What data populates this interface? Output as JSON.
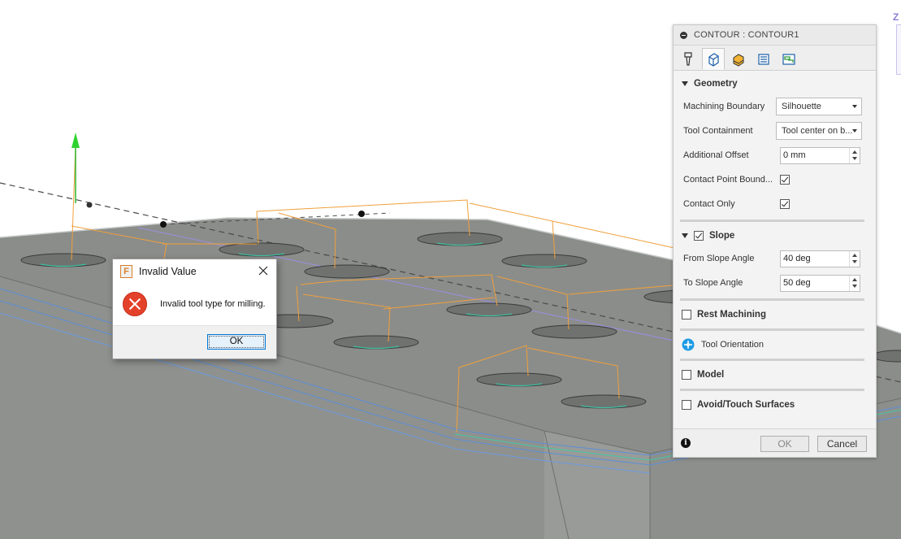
{
  "panel": {
    "title": "CONTOUR : CONTOUR1",
    "geometry": {
      "header": "Geometry",
      "machining_boundary": {
        "label": "Machining Boundary",
        "value": "Silhouette"
      },
      "tool_containment": {
        "label": "Tool Containment",
        "value": "Tool center on b..."
      },
      "additional_offset": {
        "label": "Additional Offset",
        "value": "0 mm"
      },
      "contact_point_boundary": {
        "label": "Contact Point Bound...",
        "checked": true
      },
      "contact_only": {
        "label": "Contact Only",
        "checked": true
      }
    },
    "slope": {
      "header": "Slope",
      "checked": true,
      "from_angle": {
        "label": "From Slope Angle",
        "value": "40 deg"
      },
      "to_angle": {
        "label": "To Slope Angle",
        "value": "50 deg"
      }
    },
    "rest_machining": {
      "label": "Rest Machining",
      "checked": false
    },
    "tool_orientation": {
      "label": "Tool Orientation"
    },
    "model": {
      "label": "Model",
      "checked": false
    },
    "avoid_touch": {
      "label": "Avoid/Touch Surfaces",
      "checked": false
    },
    "ok_label": "OK",
    "cancel_label": "Cancel"
  },
  "dialog": {
    "title": "Invalid Value",
    "app_letter": "F",
    "message": "Invalid tool type for milling.",
    "ok_label": "OK"
  },
  "viewcube": {
    "axis_label": "Z"
  },
  "colors": {
    "part_top": "#8d8f8c",
    "part_side": "#9a9c99",
    "toolpath": "#f0a03c",
    "contact_path": "#3fbfa0",
    "error_red": "#e4412b",
    "accent_blue": "#0078d7"
  }
}
